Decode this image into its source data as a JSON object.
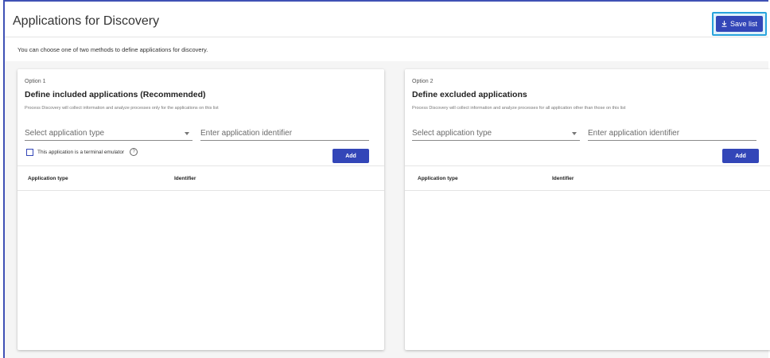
{
  "header": {
    "title": "Applications for Discovery",
    "save_label": "Save list"
  },
  "intro": "You can choose one of two methods to define applications for discovery.",
  "options": [
    {
      "option_label": "Option 1",
      "title": "Define included applications (Recommended)",
      "description": "Process Discovery will collect information and analyze processes only for the applications on this list",
      "select_placeholder": "Select application type",
      "identifier_placeholder": "Enter application identifier",
      "checkbox_label": "This application is a terminal emulator",
      "add_label": "Add",
      "columns": [
        "Application type",
        "Identifier"
      ]
    },
    {
      "option_label": "Option 2",
      "title": "Define excluded applications",
      "description": "Process Discovery will collect information and analyze processes for all application other than those on this list",
      "select_placeholder": "Select application type",
      "identifier_placeholder": "Enter application identifier",
      "add_label": "Add",
      "columns": [
        "Application type",
        "Identifier"
      ]
    }
  ],
  "colors": {
    "accent": "#3346b8",
    "highlight": "#29a3dc"
  }
}
